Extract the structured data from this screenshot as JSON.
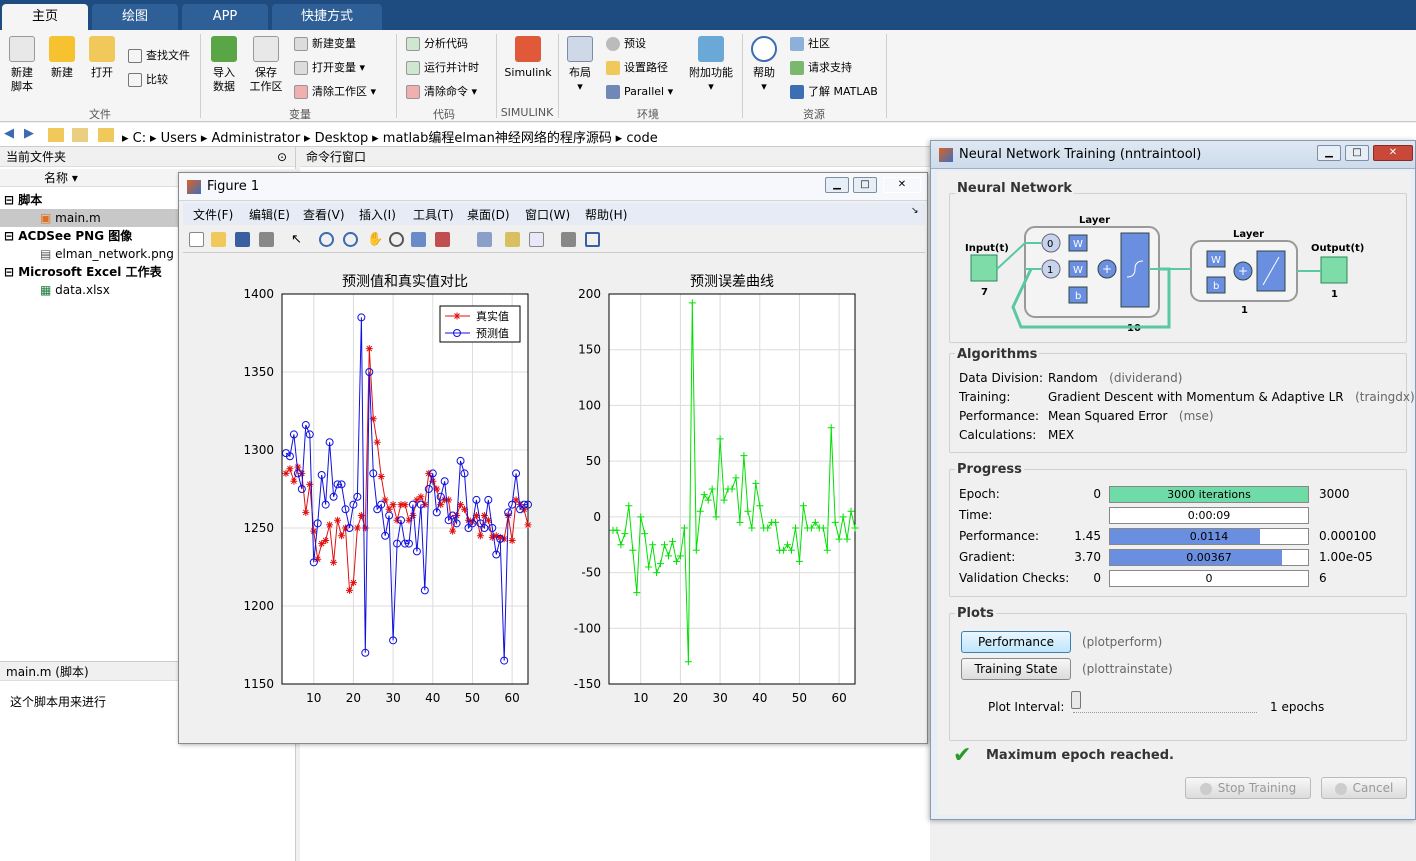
{
  "tabs": [
    "主页",
    "绘图",
    "APP",
    "快捷方式"
  ],
  "ribbon": {
    "file": {
      "new_script": "新建\n脚本",
      "new": "新建",
      "open": "打开",
      "find_files": "查找文件",
      "compare": "比较",
      "group": "文件"
    },
    "variable": {
      "import": "导入\n数据",
      "save_ws": "保存\n工作区",
      "new_var": "新建变量",
      "open_var": "打开变量",
      "clear_ws": "清除工作区",
      "group": "变量"
    },
    "code": {
      "analyze": "分析代码",
      "run_time": "运行并计时",
      "clear_cmd": "清除命令",
      "group": "代码"
    },
    "simulink": {
      "label": "Simulink",
      "group": "SIMULINK"
    },
    "env": {
      "layout": "布局",
      "prefs": "预设",
      "set_path": "设置路径",
      "parallel": "Parallel",
      "addons": "附加功能",
      "group": "环境"
    },
    "res": {
      "help": "帮助",
      "community": "社区",
      "support": "请求支持",
      "learn": "了解 MATLAB",
      "group": "资源"
    }
  },
  "address": [
    "C:",
    "Users",
    "Administrator",
    "Desktop",
    "matlab编程elman神经网络的程序源码",
    "code"
  ],
  "current_folder": {
    "title": "当前文件夹",
    "col_name": "名称",
    "groups": [
      {
        "label": "脚本",
        "files": [
          "main.m"
        ]
      },
      {
        "label": "ACDSee PNG 图像",
        "files": [
          "elman_network.png"
        ]
      },
      {
        "label": "Microsoft Excel 工作表",
        "files": [
          "data.xlsx"
        ]
      }
    ],
    "details_title": "main.m  (脚本)",
    "details_text": "这个脚本用来进行"
  },
  "command_window": {
    "title": "命令行窗口"
  },
  "figure": {
    "title": "Figure 1",
    "menu": [
      "文件(F)",
      "编辑(E)",
      "查看(V)",
      "插入(I)",
      "工具(T)",
      "桌面(D)",
      "窗口(W)",
      "帮助(H)"
    ]
  },
  "chart_data": [
    {
      "type": "line",
      "title": "预测值和真实值对比",
      "xlim": [
        2,
        64
      ],
      "ylim": [
        1150,
        1400
      ],
      "xticks": [
        10,
        20,
        30,
        40,
        50,
        60
      ],
      "yticks": [
        1150,
        1200,
        1250,
        1300,
        1350,
        1400
      ],
      "grid": true,
      "legend": "top-right",
      "x": [
        3,
        4,
        5,
        6,
        7,
        8,
        9,
        10,
        11,
        12,
        13,
        14,
        15,
        16,
        17,
        18,
        19,
        20,
        21,
        22,
        23,
        24,
        25,
        26,
        27,
        28,
        29,
        30,
        31,
        32,
        33,
        34,
        35,
        36,
        37,
        38,
        39,
        40,
        41,
        42,
        43,
        44,
        45,
        46,
        47,
        48,
        49,
        50,
        51,
        52,
        53,
        54,
        55,
        56,
        57,
        58,
        59,
        60,
        61,
        62,
        63,
        64
      ],
      "series": [
        {
          "name": "真实值",
          "color": "#e01010",
          "marker": "*",
          "values": [
            1285,
            1288,
            1280,
            1289,
            1285,
            1260,
            1278,
            1248,
            1230,
            1240,
            1242,
            1252,
            1228,
            1255,
            1245,
            1250,
            1210,
            1215,
            1250,
            1258,
            1250,
            1365,
            1320,
            1305,
            1283,
            1268,
            1262,
            1265,
            1255,
            1265,
            1265,
            1255,
            1258,
            1268,
            1270,
            1265,
            1285,
            1280,
            1275,
            1265,
            1268,
            1268,
            1248,
            1258,
            1265,
            1262,
            1255,
            1254,
            1258,
            1245,
            1258,
            1255,
            1244,
            1245,
            1244,
            1243,
            1258,
            1242,
            1268,
            1265,
            1262,
            1252
          ]
        },
        {
          "name": "预测值",
          "color": "#1010e0",
          "marker": "o",
          "values": [
            1298,
            1296,
            1310,
            1285,
            1275,
            1316,
            1310,
            1228,
            1253,
            1284,
            1265,
            1305,
            1270,
            1278,
            1278,
            1262,
            1250,
            1265,
            1270,
            1385,
            1170,
            1350,
            1285,
            1262,
            1265,
            1245,
            1258,
            1178,
            1240,
            1255,
            1240,
            1240,
            1265,
            1235,
            1265,
            1210,
            1275,
            1285,
            1260,
            1270,
            1280,
            1255,
            1258,
            1253,
            1293,
            1285,
            1250,
            1253,
            1268,
            1253,
            1250,
            1268,
            1250,
            1233,
            1243,
            1165,
            1260,
            1265,
            1285,
            1262,
            1265,
            1265
          ]
        }
      ]
    },
    {
      "type": "line",
      "title": "预测误差曲线",
      "xlim": [
        2,
        64
      ],
      "ylim": [
        -150,
        200
      ],
      "xticks": [
        10,
        20,
        30,
        40,
        50,
        60
      ],
      "yticks": [
        -150,
        -100,
        -50,
        0,
        50,
        100,
        150,
        200
      ],
      "grid": true,
      "x": [
        3,
        4,
        5,
        6,
        7,
        8,
        9,
        10,
        11,
        12,
        13,
        14,
        15,
        16,
        17,
        18,
        19,
        20,
        21,
        22,
        23,
        24,
        25,
        26,
        27,
        28,
        29,
        30,
        31,
        32,
        33,
        34,
        35,
        36,
        37,
        38,
        39,
        40,
        41,
        42,
        43,
        44,
        45,
        46,
        47,
        48,
        49,
        50,
        51,
        52,
        53,
        54,
        55,
        56,
        57,
        58,
        59,
        60,
        61,
        62,
        63,
        64
      ],
      "series": [
        {
          "color": "#00e000",
          "marker": "+",
          "values": [
            -12,
            -12,
            -25,
            -15,
            10,
            -30,
            -68,
            0,
            -15,
            -45,
            -25,
            -50,
            -42,
            -25,
            -35,
            -22,
            -40,
            -35,
            -10,
            -130,
            192,
            -30,
            5,
            20,
            15,
            25,
            0,
            70,
            15,
            25,
            25,
            35,
            -5,
            55,
            5,
            -10,
            30,
            10,
            -10,
            -10,
            -5,
            -5,
            -30,
            -30,
            -25,
            -30,
            -10,
            -40,
            10,
            -10,
            -10,
            -5,
            -10,
            -10,
            -30,
            80,
            -5,
            -20,
            0,
            -20,
            5,
            -10
          ]
        }
      ]
    }
  ],
  "nntraintool": {
    "title": "Neural Network Training (nntraintool)",
    "sections": {
      "network": "Neural Network",
      "algorithms": "Algorithms",
      "progress": "Progress",
      "plots": "Plots"
    },
    "diagram": {
      "input_label": "Input(t)",
      "input_size": "7",
      "layer1_label": "Layer",
      "layer1_size": "10",
      "layer2_label": "Layer",
      "layer2_size": "1",
      "output_label": "Output(t)",
      "output_size": "1",
      "delay0": "0",
      "delay1": "1",
      "w": "W",
      "b": "b"
    },
    "algorithms": [
      {
        "key": "Data Division:",
        "value": "Random",
        "code": "(dividerand)"
      },
      {
        "key": "Training:",
        "value": "Gradient Descent with Momentum & Adaptive LR",
        "code": "(traingdx)"
      },
      {
        "key": "Performance:",
        "value": "Mean Squared Error",
        "code": "(mse)"
      },
      {
        "key": "Calculations:",
        "value": "MEX",
        "code": ""
      }
    ],
    "progress": [
      {
        "key": "Epoch:",
        "start": "0",
        "bar": "3000 iterations",
        "end": "3000",
        "fill": 1.0,
        "color": "#6fdca8"
      },
      {
        "key": "Time:",
        "start": "",
        "bar": "0:00:09",
        "end": "",
        "fill": 0,
        "color": "#6b8fe0"
      },
      {
        "key": "Performance:",
        "start": "1.45",
        "bar": "0.0114",
        "end": "0.000100",
        "fill": 0.76,
        "color": "#6b8fe0"
      },
      {
        "key": "Gradient:",
        "start": "3.70",
        "bar": "0.00367",
        "end": "1.00e-05",
        "fill": 0.87,
        "color": "#6b8fe0"
      },
      {
        "key": "Validation Checks:",
        "start": "0",
        "bar": "0",
        "end": "6",
        "fill": 0,
        "color": "#6b8fe0"
      }
    ],
    "plots": [
      {
        "label": "Performance",
        "code": "(plotperform)"
      },
      {
        "label": "Training State",
        "code": "(plottrainstate)"
      }
    ],
    "plot_interval_label": "Plot Interval:",
    "plot_interval_value": "1 epochs",
    "status": "Maximum epoch reached.",
    "stop_label": "Stop Training",
    "cancel_label": "Cancel"
  }
}
